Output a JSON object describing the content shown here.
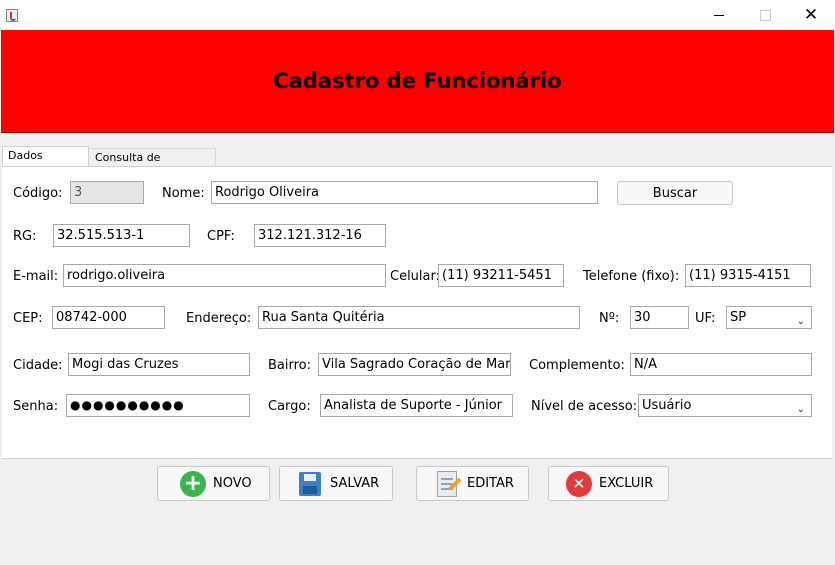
{
  "window": {
    "minimize": "—",
    "maximize": "☐",
    "close": "✕"
  },
  "header": {
    "title": "Cadastro de Funcionário"
  },
  "tabs": [
    {
      "label": "Dados pessoais",
      "active": true
    },
    {
      "label": "Consulta de funcionários",
      "active": false
    }
  ],
  "form": {
    "codigo_label": "Código:",
    "codigo_value": "3",
    "nome_label": "Nome:",
    "nome_value": "Rodrigo Oliveira",
    "buscar_label": "Buscar",
    "rg_label": "RG:",
    "rg_value": "32.515.513-1",
    "cpf_label": "CPF:",
    "cpf_value": "312.121.312-16",
    "email_label": "E-mail:",
    "email_value": "rodrigo.oliveira",
    "celular_label": "Celular:",
    "celular_value": "(11) 93211-5451",
    "telefone_label": "Telefone (fixo):",
    "telefone_value": "(11) 9315-4151",
    "cep_label": "CEP:",
    "cep_value": "08742-000",
    "endereco_label": "Endereço:",
    "endereco_value": "Rua Santa Quitéria",
    "numero_label": "Nº:",
    "numero_value": "30",
    "uf_label": "UF:",
    "uf_value": "SP",
    "cidade_label": "Cidade:",
    "cidade_value": "Mogi das Cruzes",
    "bairro_label": "Bairro:",
    "bairro_value": "Vila Sagrado Coração de Maria",
    "complemento_label": "Complemento:",
    "complemento_value": "N/A",
    "senha_label": "Senha:",
    "senha_value": "●●●●●●●●●●",
    "cargo_label": "Cargo:",
    "cargo_value": "Analista de Suporte - Júnior",
    "nivel_label": "Nível de acesso:",
    "nivel_value": "Usuário"
  },
  "actions": {
    "novo": "NOVO",
    "salvar": "SALVAR",
    "editar": "EDITAR",
    "excluir": "EXCLUIR"
  },
  "colors": {
    "banner": "#ff0000",
    "novo_icon": "#3ab54a",
    "excluir_icon": "#e33b3b",
    "salvar_icon": "#3b7fc4"
  },
  "icons": [
    "java-app-icon",
    "plus-circle-icon",
    "floppy-disk-icon",
    "notepad-pencil-icon",
    "x-circle-icon",
    "chevron-down-icon"
  ]
}
